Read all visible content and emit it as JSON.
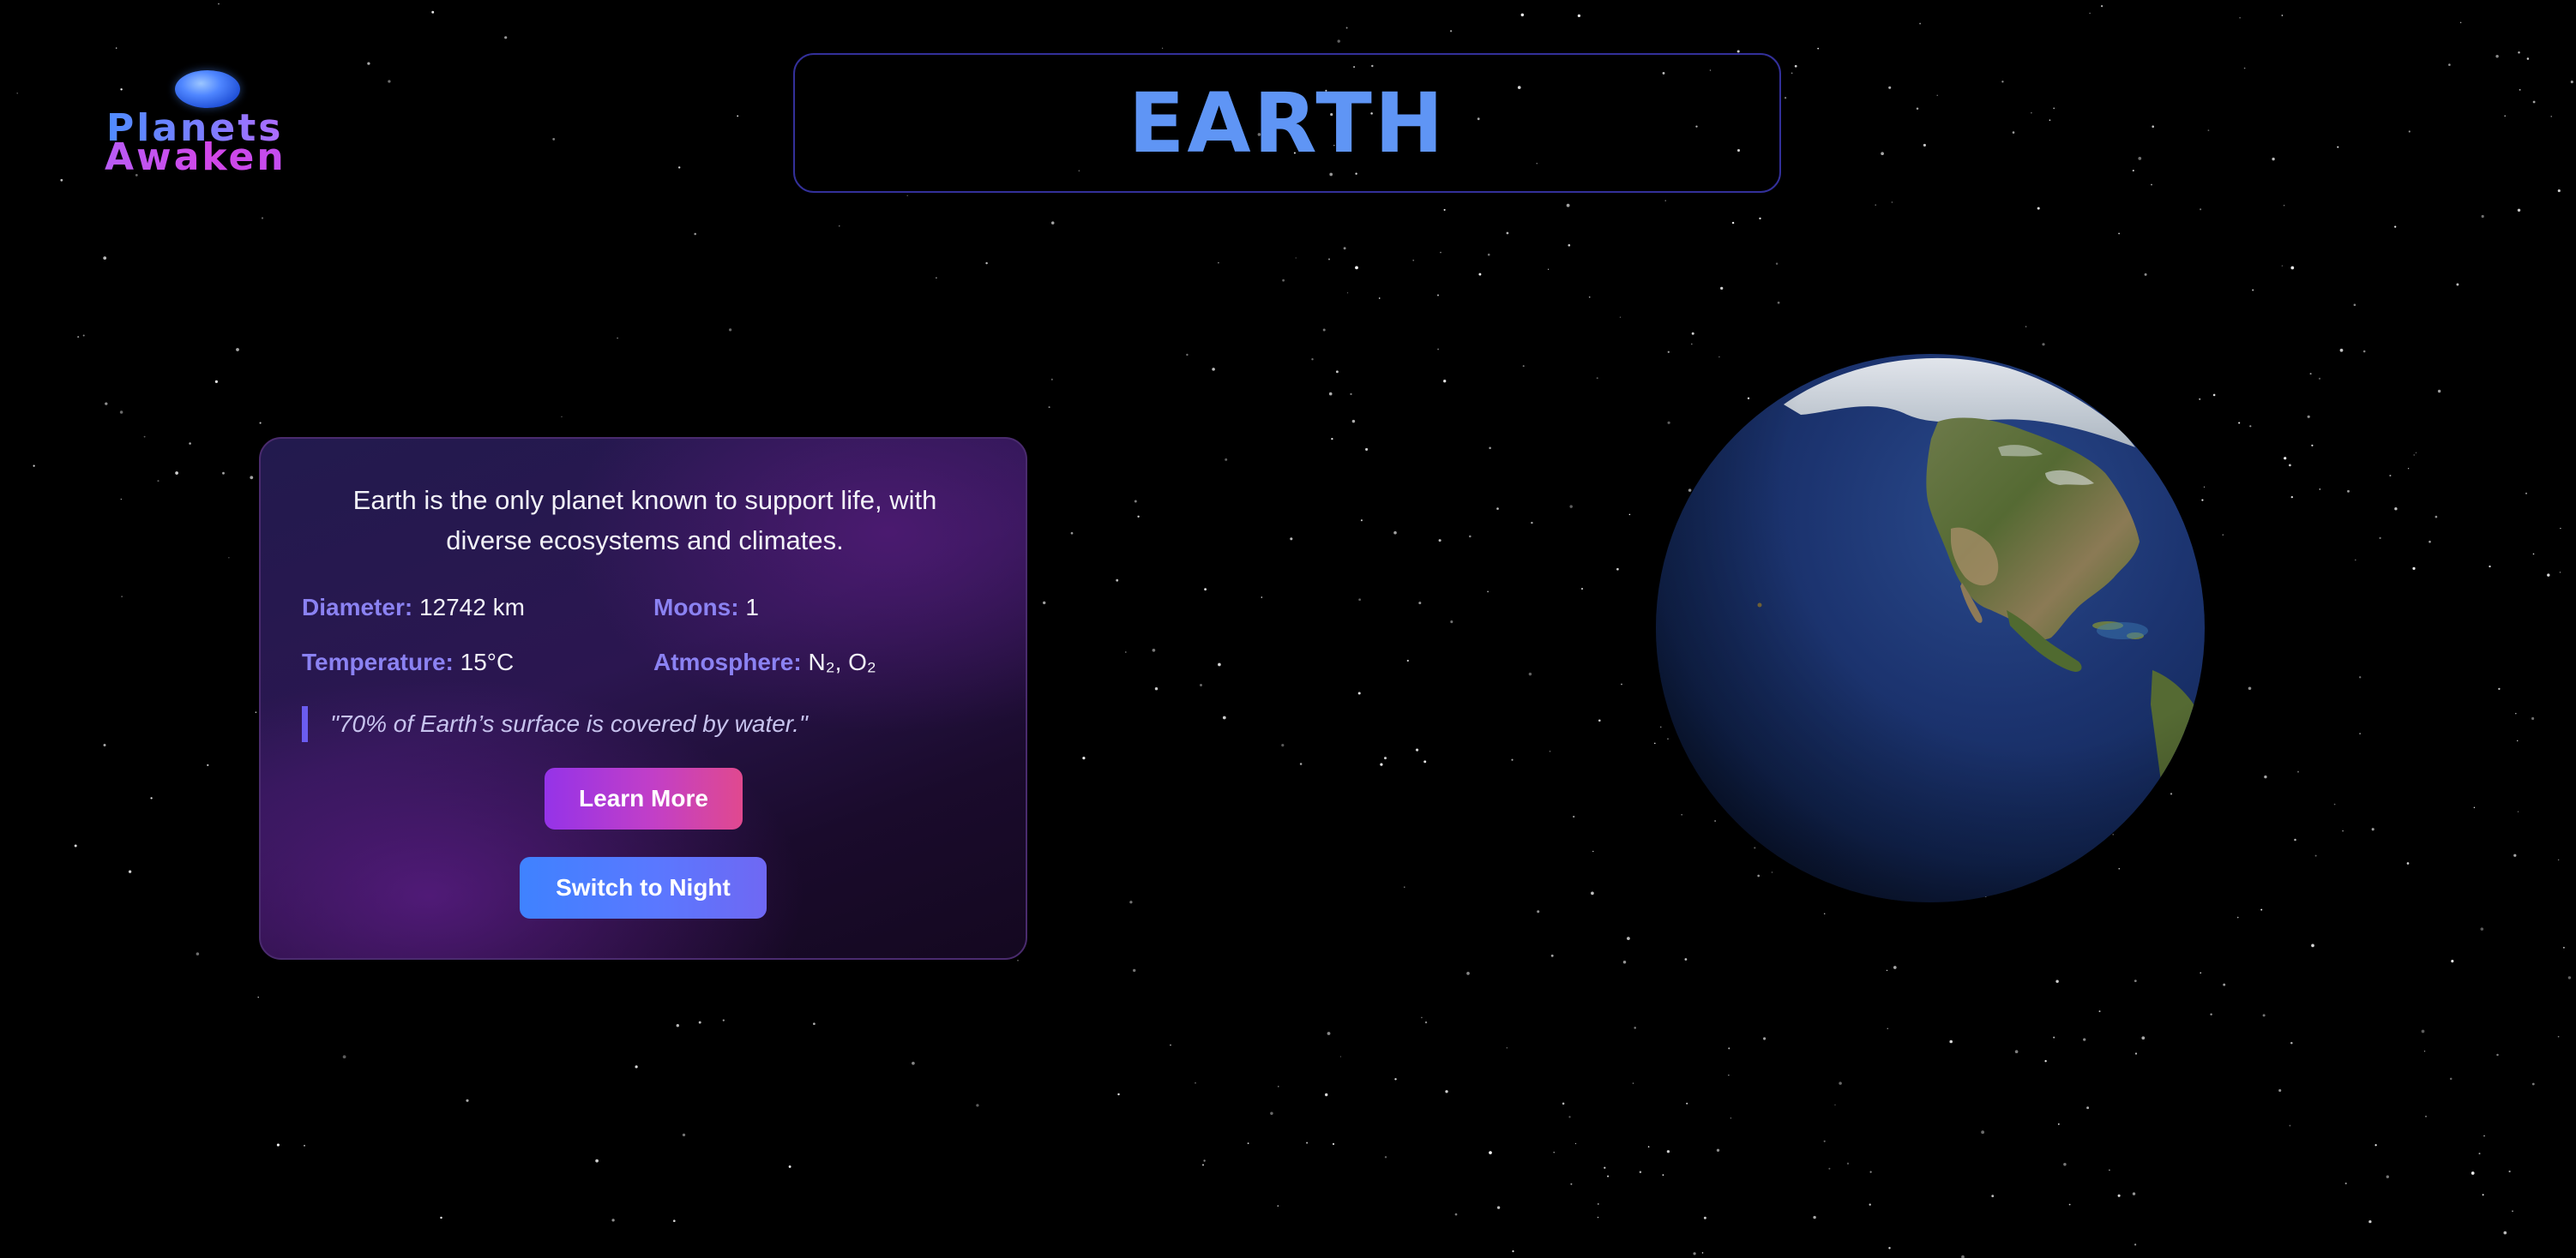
{
  "logo": {
    "line1": "Planets",
    "line2": "Awaken",
    "icon": "planet-logo-icon"
  },
  "header": {
    "title": "EARTH"
  },
  "info_card": {
    "description": "Earth is the only planet known to support life, with diverse ecosystems and climates.",
    "stats": {
      "diameter": {
        "label": "Diameter:",
        "value": "12742 km"
      },
      "moons": {
        "label": "Moons:",
        "value": "1"
      },
      "temperature": {
        "label": "Temperature:",
        "value": "15°C"
      },
      "atmosphere": {
        "label": "Atmosphere:",
        "value": "N₂, O₂"
      }
    },
    "fact_quote": "\"70% of Earth’s surface is covered by water.\"",
    "learn_more_label": "Learn More",
    "switch_label": "Switch to Night"
  },
  "colors": {
    "background": "#000000",
    "title_text": "#5f95f5",
    "title_border": "#33309a",
    "stat_label": "#8b82f2",
    "quote_bar": "#6b5cf0",
    "learn_more_gradient": [
      "#9533e8",
      "#e0498f"
    ],
    "switch_gradient": [
      "#3f82ff",
      "#6f68f3"
    ],
    "ocean": "#1a2f63",
    "land": "#5c6f3a"
  },
  "scene": {
    "planet": "earth-globe",
    "background": "starfield"
  }
}
